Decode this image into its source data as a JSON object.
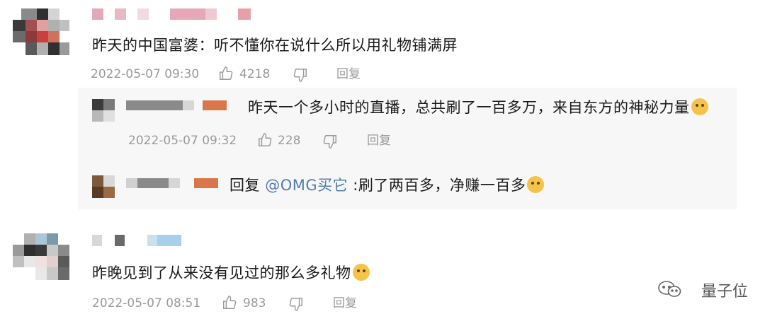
{
  "comments": [
    {
      "text": "昨天的中国富婆：听不懂你在说什么所以用礼物铺满屏",
      "time": "2022-05-07 09:30",
      "likes": "4218",
      "reply_label": "回复"
    },
    {
      "text": "昨晚见到了从来没有见过的那么多礼物",
      "time": "2022-05-07 08:51",
      "likes": "983",
      "reply_label": "回复"
    }
  ],
  "sub_replies": [
    {
      "text": "昨天一个多小时的直播，总共刷了一百多万，来自东方的神秘力量",
      "time": "2022-05-07 09:32",
      "likes": "228",
      "reply_label": "回复"
    },
    {
      "reply_prefix": "回复",
      "mention": "@OMG买它",
      "text": ":刷了两百多，净赚一百多"
    }
  ],
  "watermark": "量子位",
  "colors": {
    "meta": "#9a9a9a",
    "mention": "#507daf",
    "sub_bg": "#f7f7f7"
  }
}
